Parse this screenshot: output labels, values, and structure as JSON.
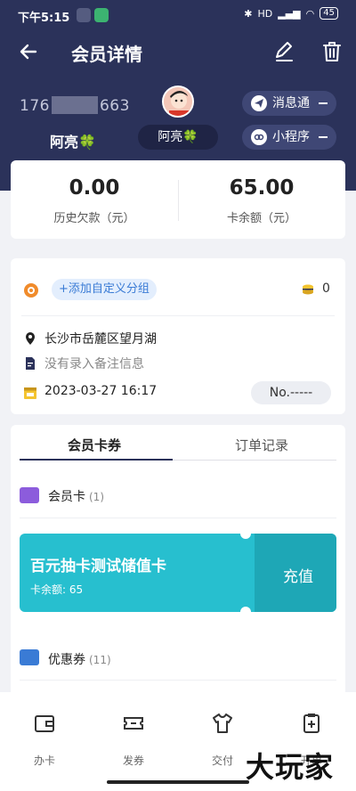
{
  "status_bar": {
    "time": "下午5:15",
    "battery": "45",
    "network": "HD"
  },
  "header": {
    "title": "会员详情",
    "phone_prefix": "176",
    "phone_suffix": "663",
    "name": "阿亮🍀",
    "name_chip": "阿亮🍀",
    "msg_btn": "消息通",
    "mini_btn": "小程序"
  },
  "balance": {
    "debt_value": "0.00",
    "debt_label": "历史欠款（元）",
    "card_value": "65.00",
    "card_label": "卡余额（元）"
  },
  "info": {
    "add_group": "+添加自定义分组",
    "points": "0",
    "address": "长沙市岳麓区望月湖",
    "remark": "没有录入备注信息",
    "date": "2023-03-27 16:17",
    "number": "No.-----"
  },
  "tabs": [
    {
      "label": "会员卡券",
      "active": true
    },
    {
      "label": "订单记录",
      "active": false
    }
  ],
  "cards_section": {
    "member_card_title": "会员卡",
    "member_card_count": "(1)",
    "stored_card": {
      "name": "百元抽卡测试储值卡",
      "balance": "卡余额: 65",
      "action": "充值"
    },
    "coupon_title": "优惠券",
    "coupon_count": "(11)"
  },
  "bottom_nav": [
    {
      "label": "办卡",
      "icon": "wallet-icon"
    },
    {
      "label": "发券",
      "icon": "ticket-icon"
    },
    {
      "label": "交付",
      "icon": "shirt-icon"
    },
    {
      "label": "开单",
      "icon": "clipboard-plus-icon"
    }
  ],
  "watermark": "大玩家",
  "colors": {
    "header_bg": "#2b325a",
    "accent_teal": "#27bfcf",
    "tag_blue": "#3a7bd5"
  }
}
